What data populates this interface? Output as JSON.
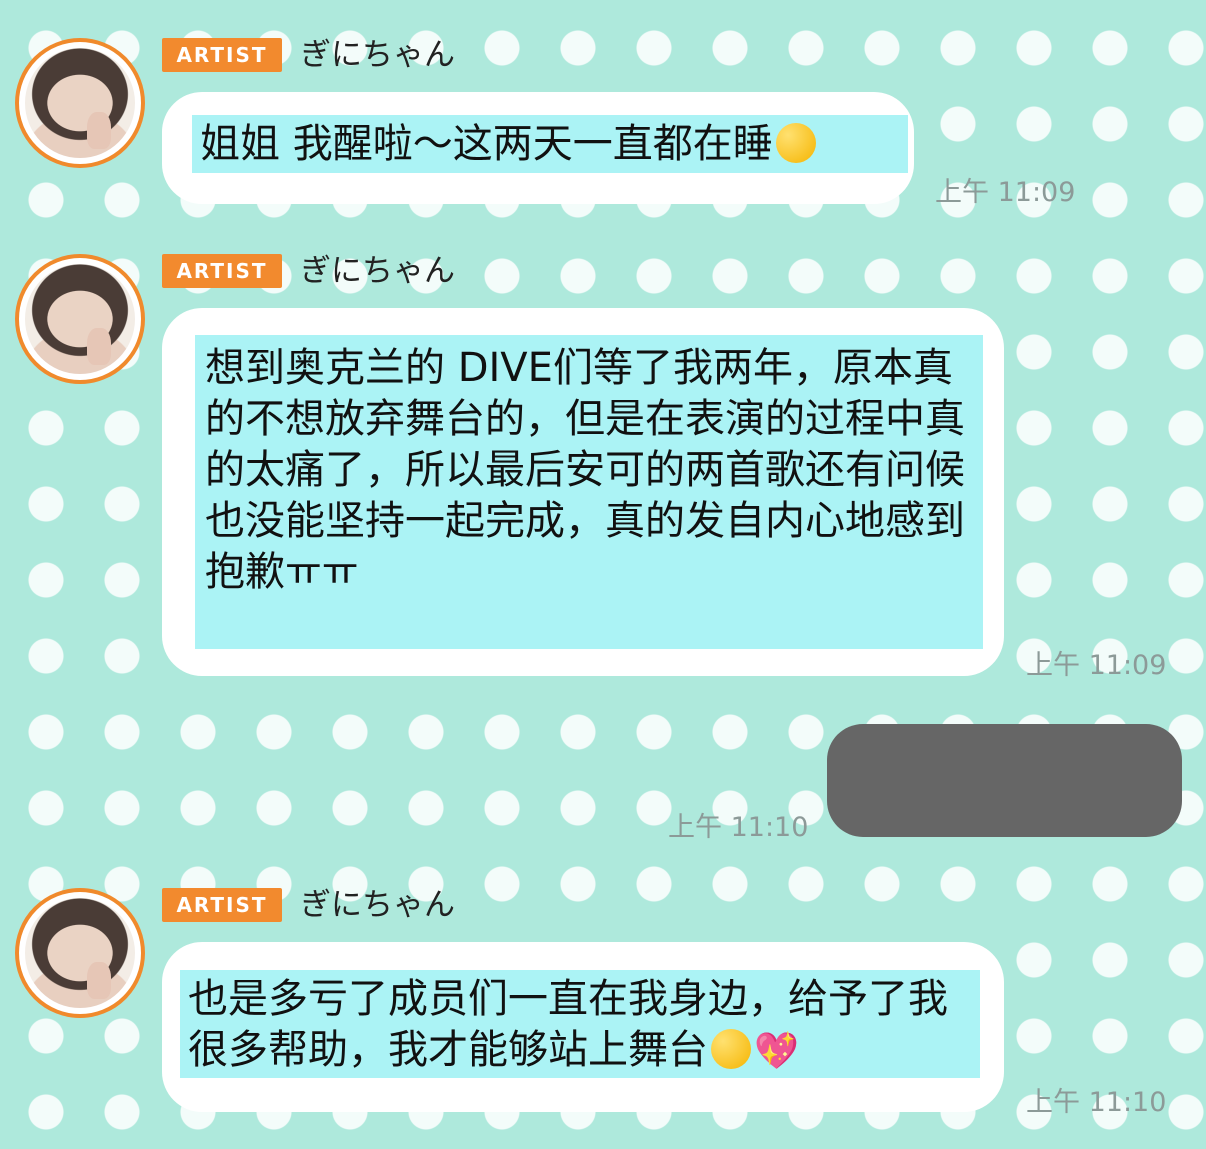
{
  "messages": [
    {
      "badge": "ARTIST",
      "sender": "ぎにちゃん",
      "text": "姐姐 我醒啦～这两天一直都在睡",
      "emoji": "crying-smiling-face",
      "time": "上午 11:09"
    },
    {
      "badge": "ARTIST",
      "sender": "ぎにちゃん",
      "text": "想到奥克兰的 DIVE们等了我两年，原本真的不想放弃舞台的，但是在表演的过程中真的太痛了，所以最后安可的两首歌还有问候也没能坚持一起完成，真的发自内心地感到抱歉ㅠㅠ",
      "time": "上午 11:09"
    },
    {
      "sender_side": "self",
      "redacted": true,
      "time": "上午 11:10"
    },
    {
      "badge": "ARTIST",
      "sender": "ぎにちゃん",
      "text": "也是多亏了成员们一直在我身边，给予了我很多帮助，我才能够站上舞台",
      "emoji": [
        "pleading-face",
        "sparkling-heart"
      ],
      "heart_glyph": "💖",
      "time": "上午 11:10"
    }
  ],
  "colors": {
    "background": "#aee9dc",
    "badge": "#f28a2e",
    "avatar_ring": "#f08a2c",
    "highlight": "#abf3f5",
    "redacted": "#666666",
    "time": "#8c9a98"
  }
}
